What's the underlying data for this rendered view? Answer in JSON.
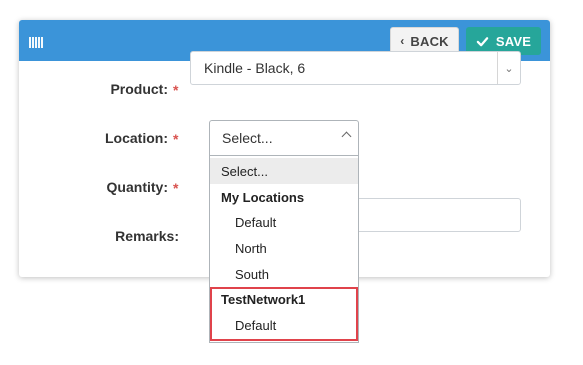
{
  "header": {
    "icon": "bars-icon",
    "back_label": "BACK",
    "save_label": "SAVE",
    "color": "#3b94d9",
    "save_color": "#26a69a"
  },
  "form": {
    "product": {
      "label": "Product:",
      "required": "*",
      "value": "Kindle - Black, 6"
    },
    "location": {
      "label": "Location:",
      "required": "*",
      "value": "Select..."
    },
    "quantity": {
      "label": "Quantity:",
      "required": "*"
    },
    "remarks": {
      "label": "Remarks:"
    }
  },
  "dropdown": {
    "placeholder": "Select...",
    "groups": [
      {
        "name": "My Locations",
        "options": [
          "Default",
          "North",
          "South"
        ]
      },
      {
        "name": "TestNetwork1",
        "options": [
          "Default"
        ]
      }
    ]
  },
  "highlight_color": "#e0434b"
}
